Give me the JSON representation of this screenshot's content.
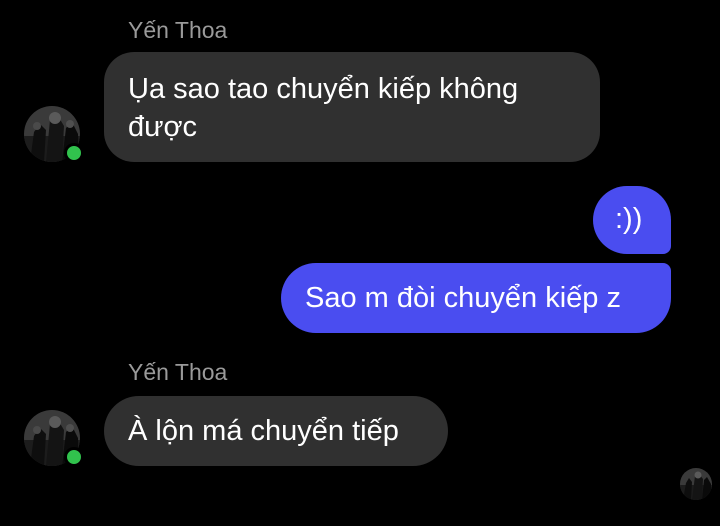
{
  "colors": {
    "background": "#000000",
    "incoming_bubble": "#303030",
    "outgoing_bubble": "#4a4df0",
    "sender_name": "#9a9a9a",
    "online_indicator": "#31c24d"
  },
  "conversation": {
    "groups": [
      {
        "sender": "Yến Thoa",
        "messages": [
          "Ụa sao tao chuyển kiếp không được"
        ]
      },
      {
        "sender": "me",
        "messages": [
          ":))",
          "Sao m đòi chuyển kiếp z"
        ]
      },
      {
        "sender": "Yến Thoa",
        "messages": [
          "À lộn má chuyển tiếp"
        ]
      }
    ]
  }
}
